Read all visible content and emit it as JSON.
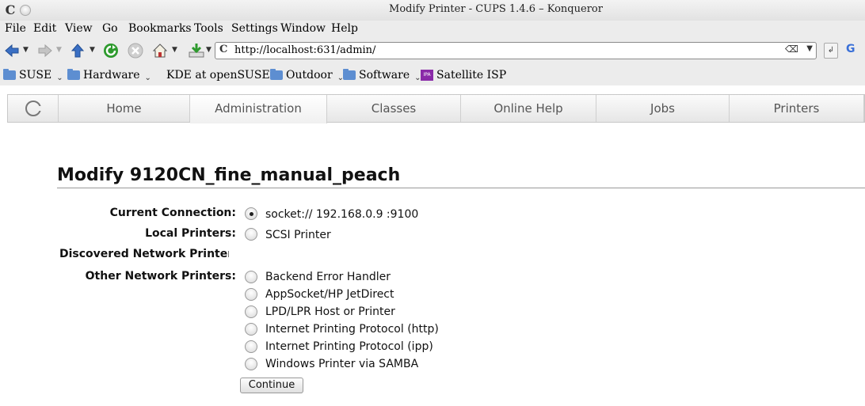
{
  "window": {
    "title": "Modify Printer - CUPS 1.4.6 – Konqueror",
    "app_icon": "C"
  },
  "menu": [
    "File",
    "Edit",
    "View",
    "Go",
    "Bookmarks",
    "Tools",
    "Settings",
    "Window",
    "Help"
  ],
  "address_bar": {
    "url": "http://localhost:631/admin/"
  },
  "bookmarks": [
    "SUSE",
    "Hardware",
    "KDE at openSUSE",
    "Outdoor",
    "Software",
    "Satellite ISP"
  ],
  "bookmark_icons": {
    "ipa": "IPA"
  },
  "nav_tabs": [
    "Home",
    "Administration",
    "Classes",
    "Online Help",
    "Jobs",
    "Printers"
  ],
  "active_tab": "Administration",
  "page": {
    "heading": "Modify 9120CN_fine_manual_peach",
    "current_connection_label": "Current Connection:",
    "current_connection_value": "socket:// 192.168.0.9 :9100",
    "local_printers_label": "Local Printers:",
    "local_printers": [
      "SCSI Printer"
    ],
    "discovered_label": "Discovered Network Printers",
    "other_label": "Other Network Printers:",
    "other_printers": [
      "Backend Error Handler",
      "AppSocket/HP JetDirect",
      "LPD/LPR Host or Printer",
      "Internet Printing Protocol (http)",
      "Internet Printing Protocol (ipp)",
      "Windows Printer via SAMBA"
    ],
    "continue_label": "Continue"
  }
}
